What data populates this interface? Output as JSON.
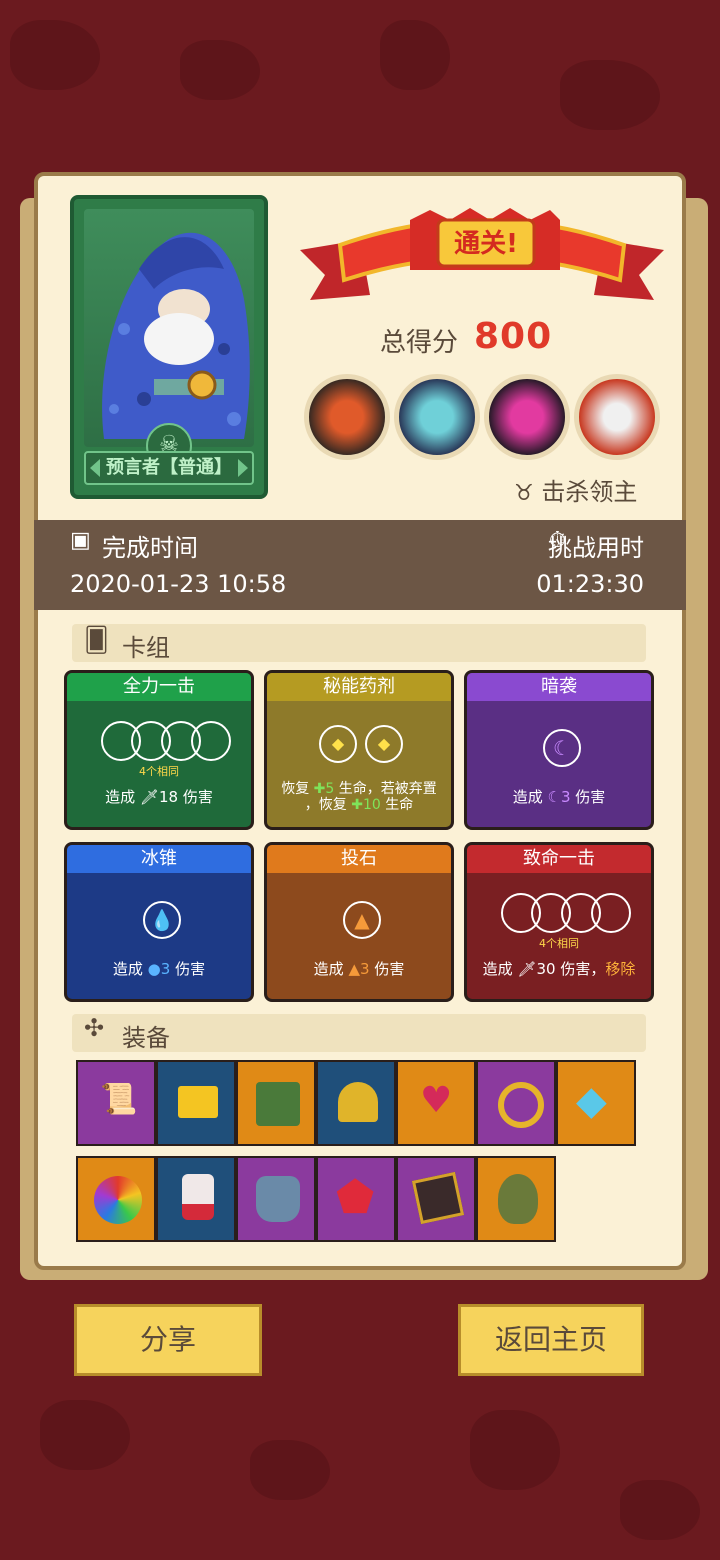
{
  "hero": {
    "name": "预言者【普通】"
  },
  "result": {
    "banner": "通关!",
    "score_label": "总得分",
    "score_value": "800",
    "kill_label": "击杀领主"
  },
  "time": {
    "finish_label": "完成时间",
    "finish_value": "2020-01-23 10:58",
    "challenge_label": "挑战用时",
    "challenge_value": "01:23:30"
  },
  "deck": {
    "label": "卡组",
    "cards": [
      {
        "title": "全力一击",
        "same": "4个相同",
        "desc_pre": "造成",
        "desc_value": "18",
        "desc_post": "伤害",
        "color": "#1f6a3a",
        "title_bg": "#1fa14a"
      },
      {
        "title": "秘能药剂",
        "desc_line1_a": "恢复",
        "desc_line1_v": "5",
        "desc_line1_b": "生命，若被弃置",
        "desc_line2_a": "，恢复",
        "desc_line2_v": "10",
        "desc_line2_b": "生命",
        "color": "#8e7a2a",
        "title_bg": "#b59b22"
      },
      {
        "title": "暗袭",
        "desc_pre": "造成",
        "desc_value": "3",
        "desc_post": "伤害",
        "color": "#5a2f84",
        "title_bg": "#8a4ad0"
      },
      {
        "title": "冰锥",
        "desc_pre": "造成",
        "desc_value": "3",
        "desc_post": "伤害",
        "color": "#1d3a86",
        "title_bg": "#2f6de0"
      },
      {
        "title": "投石",
        "desc_pre": "造成",
        "desc_value": "3",
        "desc_post": "伤害",
        "color": "#8d4a1d",
        "title_bg": "#e07a1c"
      },
      {
        "title": "致命一击",
        "same": "4个相同",
        "desc_pre": "造成",
        "desc_value": "30",
        "desc_post": "伤害，",
        "desc_extra": "移除",
        "color": "#7a1f22",
        "title_bg": "#c32a2e"
      }
    ]
  },
  "equipment": {
    "label": "装备",
    "items": [
      {
        "icon": "scroll-icon",
        "bg": "#8b3a9e"
      },
      {
        "icon": "gold-bar-icon",
        "bg": "#1f4f7a"
      },
      {
        "icon": "moss-tome-icon",
        "bg": "#e08a16"
      },
      {
        "icon": "helmet-icon",
        "bg": "#1f4f7a"
      },
      {
        "icon": "crown-heart-icon",
        "bg": "#e08a16"
      },
      {
        "icon": "ring-icon",
        "bg": "#8b3a9e"
      },
      {
        "icon": "crystal-shield-icon",
        "bg": "#e08a16"
      },
      {
        "icon": "rainbow-orb-icon",
        "bg": "#e08a16"
      },
      {
        "icon": "potion-jar-icon",
        "bg": "#1f4f7a"
      },
      {
        "icon": "armor-icon",
        "bg": "#8b3a9e"
      },
      {
        "icon": "ruby-icon",
        "bg": "#8b3a9e"
      },
      {
        "icon": "spellbook-icon",
        "bg": "#8b3a9e"
      },
      {
        "icon": "skull-mask-icon",
        "bg": "#e08a16"
      }
    ]
  },
  "buttons": {
    "share": "分享",
    "home": "返回主页"
  }
}
